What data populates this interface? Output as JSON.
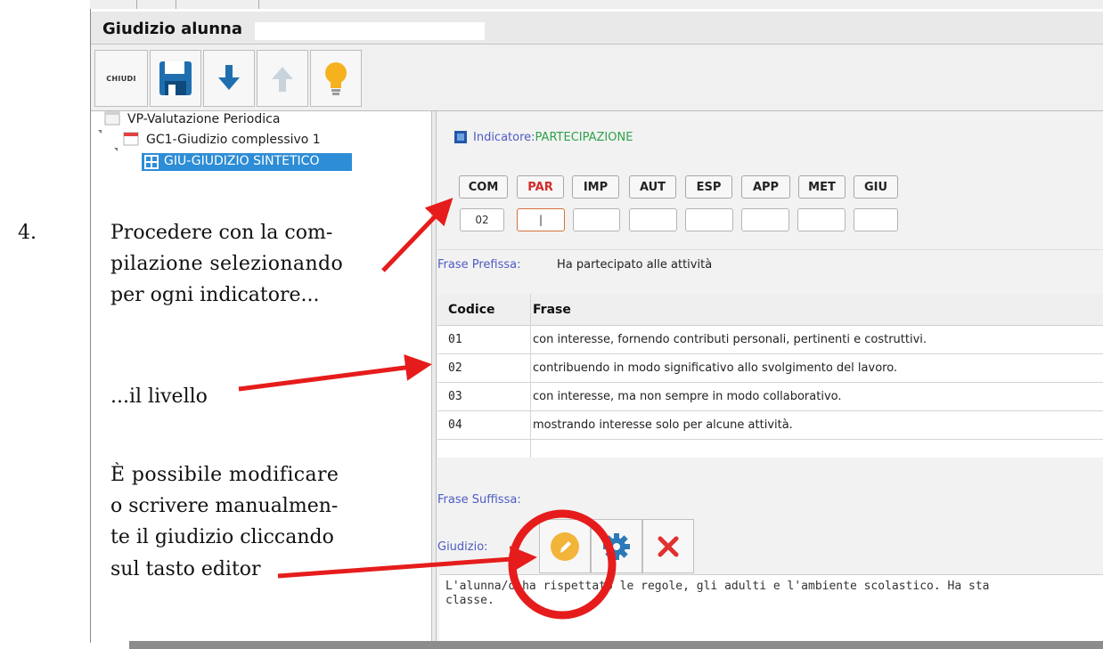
{
  "window": {
    "title": "Giudizio alunna"
  },
  "toolbar": {
    "close_label": "CHIUDI",
    "buttons": [
      "floppy-save-icon",
      "arrow-down-icon",
      "arrow-up-icon",
      "lightbulb-icon"
    ]
  },
  "tree": {
    "root": "VP-Valutazione Periodica",
    "child": "GC1-Giudizio complessivo 1",
    "selected": "GIU-GIUDIZIO SINTETICO"
  },
  "indicator": {
    "label": "Indicatore:",
    "value": "PARTECIPAZIONE"
  },
  "codes": [
    "COM",
    "PAR",
    "IMP",
    "AUT",
    "ESP",
    "APP",
    "MET",
    "GIU"
  ],
  "code_values": [
    "02",
    "|",
    "",
    "",
    "",
    "",
    "",
    ""
  ],
  "active_code_color": "#d42a2a",
  "prefix": {
    "label": "Frase Prefissa:",
    "value": "Ha partecipato alle attività"
  },
  "table": {
    "headers": [
      "Codice",
      "Frase"
    ],
    "rows": [
      {
        "code": "01",
        "text": "con interesse, fornendo contributi personali, pertinenti e costruttivi."
      },
      {
        "code": "02",
        "text": "contribuendo in modo significativo allo svolgimento del lavoro."
      },
      {
        "code": "03",
        "text": "con interesse, ma non sempre in modo collaborativo."
      },
      {
        "code": "04",
        "text": "mostrando interesse solo per alcune attività."
      }
    ]
  },
  "suffix": {
    "label": "Frase Suffissa:"
  },
  "giudizio": {
    "label": "Giudizio:",
    "text": "L'alunna/o ha rispettato le regole, gli adulti e l'ambiente scolastico. Ha sta\nclasse."
  },
  "annotations": {
    "step_number": "4.",
    "step_lines": [
      "Procedere con la com-",
      "pilazione selezionando",
      "per ogni indicatore..."
    ],
    "level_text": "...il livello",
    "editor_lines": [
      "È possibile modificare",
      "o scrivere manualmen-",
      "te il giudizio cliccando",
      "sul tasto editor"
    ]
  },
  "colors": {
    "arrow": "#e61c1c",
    "selection": "#2d8dd6",
    "indicator_green": "#2ea24a",
    "label_blue": "#4e5bc4"
  }
}
